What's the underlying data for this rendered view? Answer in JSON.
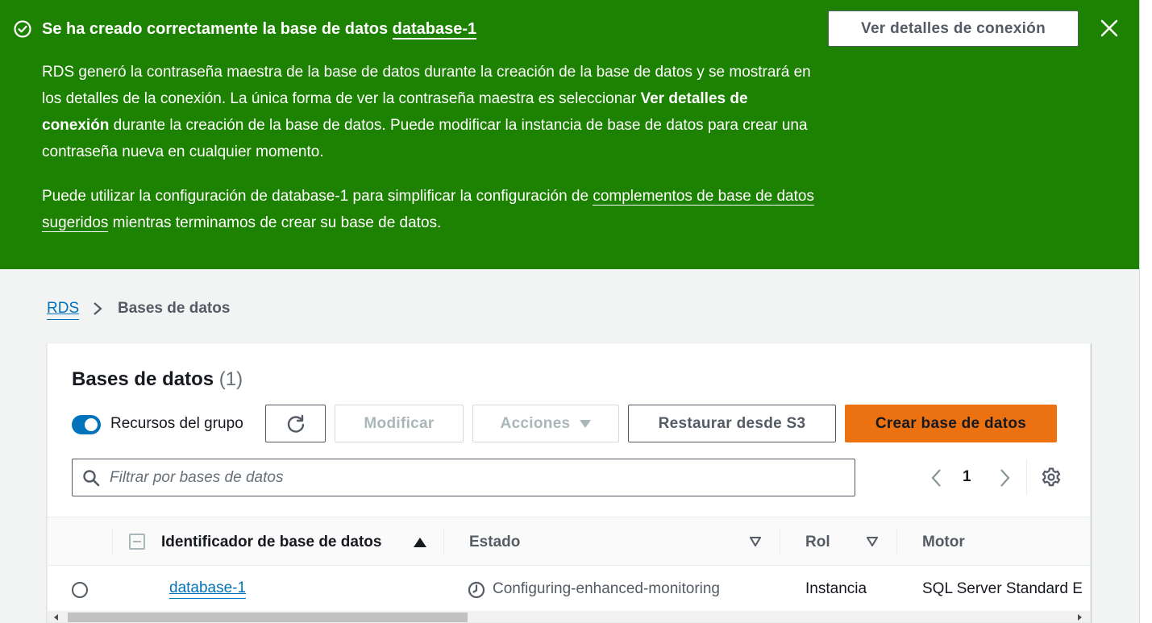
{
  "flash": {
    "title_prefix": "Se ha creado correctamente la base de datos ",
    "title_link": "database-1",
    "p1_text_a": "RDS generó la contraseña maestra de la base de datos durante la creación de la base de datos y se mostrará en los detalles de la conexión. La única forma de ver la contraseña maestra es seleccionar ",
    "p1_bold": "Ver detalles de conexión",
    "p1_text_b": " durante la creación de la base de datos. Puede modificar la instancia de base de datos para crear una contraseña nueva en cualquier momento.",
    "p2_text_a": "Puede utilizar la configuración de database-1 para simplificar la configuración de ",
    "p2_link": "complementos de base de datos sugeridos",
    "p2_text_b": " mientras terminamos de crear su base de datos.",
    "connection_button": "Ver detalles de conexión",
    "icon": "check-circle-icon",
    "close_icon": "close-icon",
    "color": "#1d8102"
  },
  "breadcrumb": {
    "root": "RDS",
    "current": "Bases de datos"
  },
  "panel": {
    "title": "Bases de datos",
    "count": "(1)",
    "toggle_label": "Recursos del grupo",
    "toggle_on": true,
    "buttons": {
      "refresh_icon": "refresh-icon",
      "modify": "Modificar",
      "actions": "Acciones",
      "restore": "Restaurar desde S3",
      "create": "Crear base de datos"
    },
    "search": {
      "placeholder": "Filtrar por bases de datos",
      "value": ""
    },
    "pagination": {
      "current_page": "1"
    }
  },
  "table": {
    "columns": {
      "identifier": "Identificador de base de datos",
      "status": "Estado",
      "role": "Rol",
      "engine": "Motor"
    },
    "rows": [
      {
        "identifier": "database-1",
        "status": "Configuring-enhanced-monitoring",
        "role": "Instancia",
        "engine": "SQL Server Standard E"
      }
    ]
  },
  "colors": {
    "success": "#1d8102",
    "primary_button": "#ec7211",
    "link": "#0073bb",
    "toggle": "#0073bb"
  }
}
